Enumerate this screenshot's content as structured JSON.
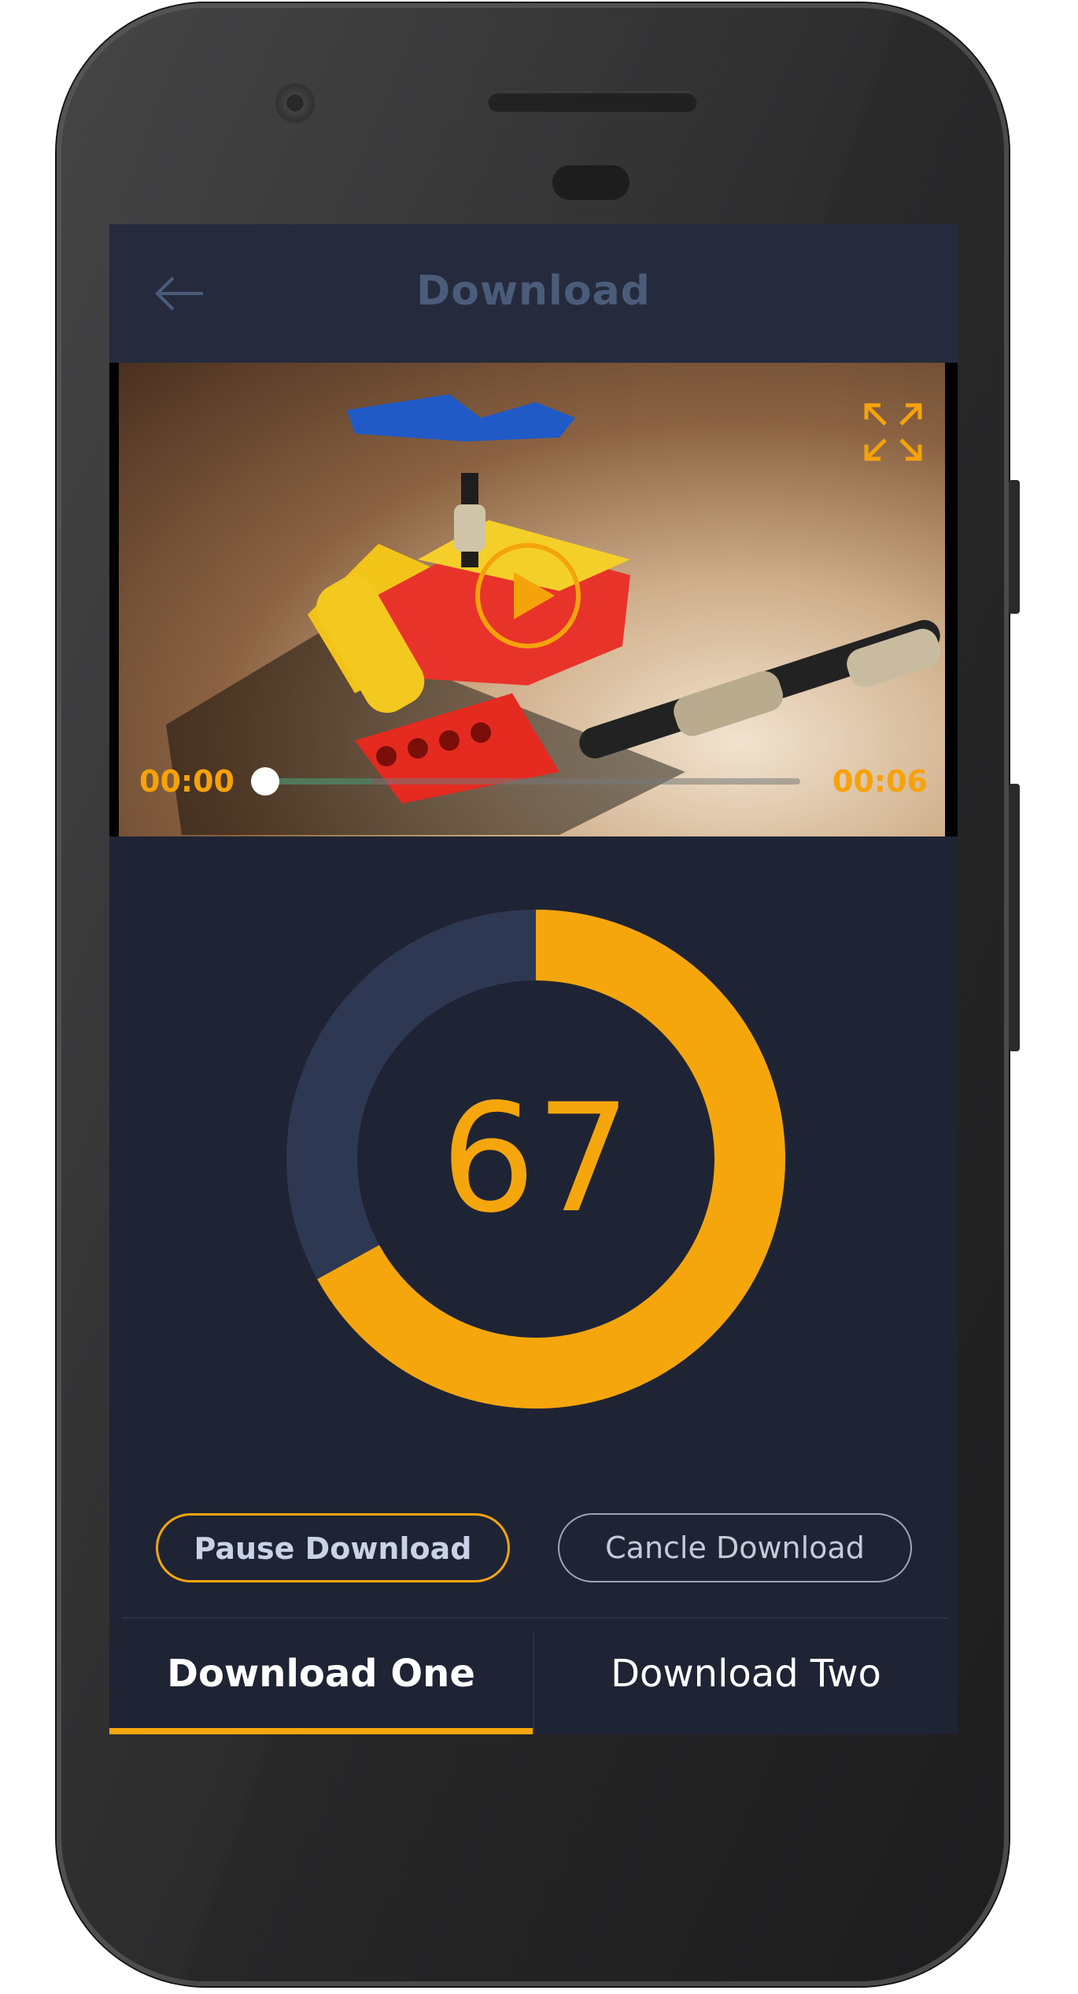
{
  "header": {
    "title": "Download",
    "back_icon": "arrow-left-icon"
  },
  "video": {
    "time_start": "00:00",
    "time_end": "00:06",
    "progress": 0.0,
    "buffered": 0.2,
    "play_icon": "play-icon",
    "fullscreen_icon": "fullscreen-expand-icon"
  },
  "download": {
    "progress_value": "67",
    "progress_percent": 67,
    "accent_color": "#f5a60c",
    "track_color": "#2e3853"
  },
  "actions": {
    "pause_label": "Pause Download",
    "cancel_label": "Cancle Download"
  },
  "tabs": [
    {
      "label": "Download One",
      "active": true
    },
    {
      "label": "Download Two",
      "active": false
    }
  ],
  "colors": {
    "screen_bg": "#1f2434",
    "header_bg": "#252b3d",
    "accent": "#f5a60c"
  }
}
